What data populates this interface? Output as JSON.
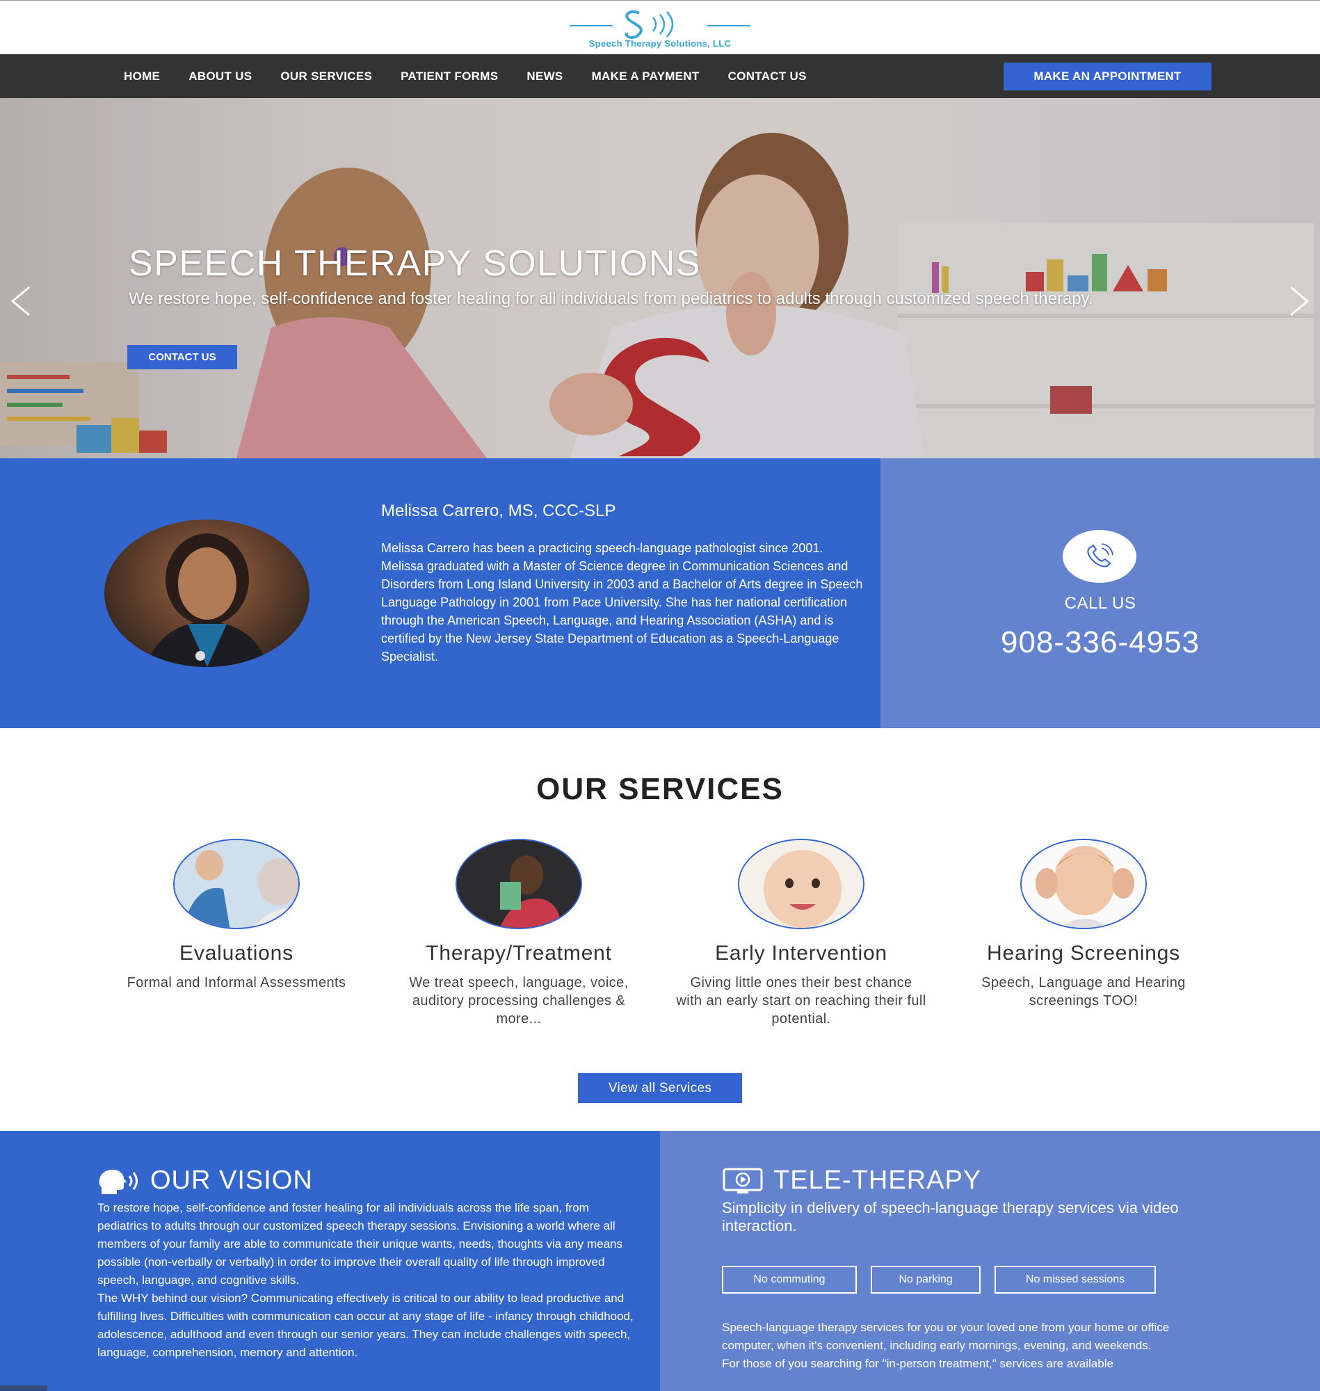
{
  "header": {
    "logo_text": "Speech Therapy Solutions, LLC",
    "logo_icon": "speech-s-sound-waves-icon"
  },
  "nav": {
    "items": [
      "HOME",
      "ABOUT US",
      "OUR SERVICES",
      "PATIENT FORMS",
      "NEWS",
      "MAKE A PAYMENT",
      "CONTACT US"
    ],
    "cta": "MAKE AN APPOINTMENT"
  },
  "hero": {
    "title": "SPEECH THERAPY SOLUTIONS",
    "subtitle": "We restore hope, self-confidence and foster healing for all individuals from pediatrics to adults through customized speech therapy.",
    "button": "CONTACT US",
    "prev_icon": "chevron-left-icon",
    "next_icon": "chevron-right-icon"
  },
  "bio": {
    "name": "Melissa Carrero, MS, CCC-SLP",
    "text": "Melissa Carrero has been a practicing speech-language pathologist since 2001. Melissa graduated with a Master of Science degree in Communication Sciences and Disorders from Long Island University in 2003 and a Bachelor of Arts degree in Speech Language Pathology in 2001 from Pace University. She has her national certification through the American Speech, Language, and Hearing Association (ASHA) and is certified by the New Jersey State Department of Education as a Speech-Language Specialist.",
    "call_label": "CALL US",
    "phone": "908-336-4953"
  },
  "services": {
    "heading": "OUR SERVICES",
    "items": [
      {
        "title": "Evaluations",
        "desc": "Formal and Informal Assessments"
      },
      {
        "title": "Therapy/Treatment",
        "desc": "We treat speech, language, voice, auditory processing challenges & more..."
      },
      {
        "title": "Early Intervention",
        "desc": "Giving little ones their best chance with an early start on reaching their full potential."
      },
      {
        "title": "Hearing Screenings",
        "desc": "Speech, Language and Hearing screenings TOO!"
      }
    ],
    "button": "View all Services"
  },
  "vision": {
    "title": "OUR VISION",
    "text": "To restore hope, self-confidence and foster healing for all individuals across the life span, from pediatrics to adults through our customized speech therapy sessions. Envisioning a world where all members of your family are able to communicate their unique wants, needs, thoughts via any means possible (non-verbally or verbally) in order to improve their overall quality of life through improved speech, language, and cognitive skills.",
    "text2": "The WHY behind our vision? Communicating effectively is critical to our ability to lead productive and fulfilling lives. Difficulties with communication can occur at any stage of life - infancy through childhood, adolescence, adulthood and even through our senior years. They can include challenges with speech, language, comprehension, memory and attention."
  },
  "tele": {
    "title": "TELE-THERAPY",
    "subtitle": "Simplicity in delivery of speech-language therapy services via video interaction.",
    "pills": [
      "No commuting",
      "No parking",
      "No missed sessions"
    ],
    "text": "Speech-language therapy services for you or your loved one from your home or office computer, when it's convenient, including early mornings, evening, and weekends.",
    "text2": "For those of you searching for \"in-person treatment,\" services are available"
  },
  "colors": {
    "primary_blue": "#3366cc",
    "light_blue": "#6383cf",
    "button_blue": "#3463d2",
    "nav_bg": "#333333"
  }
}
